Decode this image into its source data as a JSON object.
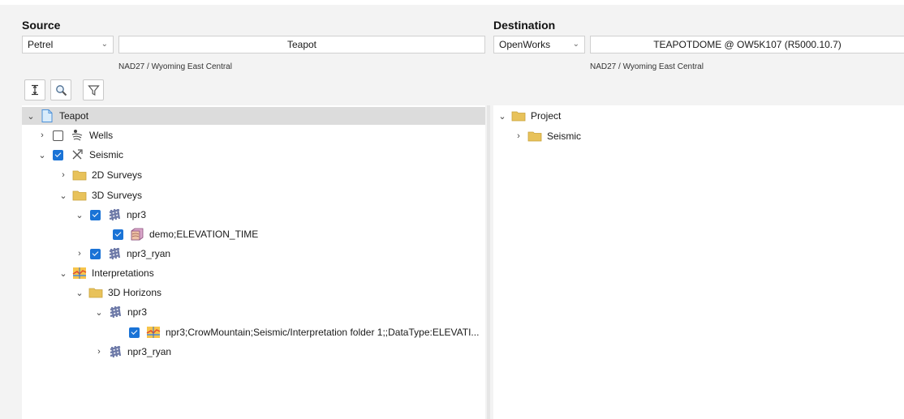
{
  "source": {
    "heading": "Source",
    "app_select": "Petrel",
    "project_name": "Teapot",
    "crs": "NAD27 / Wyoming East Central"
  },
  "destination": {
    "heading": "Destination",
    "app_select": "OpenWorks",
    "project_name": "TEAPOTDOME @ OW5K107 (R5000.10.7)",
    "crs": "NAD27 / Wyoming East Central"
  },
  "toolbar": {
    "buttons": [
      "expand-collapse",
      "search",
      "filter"
    ]
  },
  "source_tree": [
    {
      "label": "Teapot",
      "icon": "file-icon",
      "state": "expanded",
      "selected": true
    },
    {
      "label": "Wells",
      "icon": "wells-icon",
      "state": "collapsed",
      "checked": false
    },
    {
      "label": "Seismic",
      "icon": "seismic-icon",
      "state": "expanded",
      "checked": true
    },
    {
      "label": "2D Surveys",
      "icon": "folder-icon",
      "state": "collapsed"
    },
    {
      "label": "3D Surveys",
      "icon": "folder-icon",
      "state": "expanded"
    },
    {
      "label": "npr3",
      "icon": "survey-icon",
      "state": "expanded",
      "checked": true
    },
    {
      "label": "demo;ELEVATION_TIME",
      "icon": "seismic-cube-icon",
      "checked": true
    },
    {
      "label": "npr3_ryan",
      "icon": "survey-icon",
      "state": "collapsed",
      "checked": true
    },
    {
      "label": "Interpretations",
      "icon": "interpretation-icon",
      "state": "expanded"
    },
    {
      "label": "3D Horizons",
      "icon": "folder-icon",
      "state": "expanded"
    },
    {
      "label": "npr3",
      "icon": "survey-icon",
      "state": "expanded"
    },
    {
      "label": "npr3;CrowMountain;Seismic/Interpretation folder 1;;DataType:ELEVATI...",
      "icon": "interpretation-icon",
      "checked": true
    },
    {
      "label": "npr3_ryan",
      "icon": "survey-icon",
      "state": "collapsed"
    }
  ],
  "dest_tree": [
    {
      "label": "Project",
      "icon": "folder-icon",
      "state": "expanded"
    },
    {
      "label": "Seismic",
      "icon": "folder-icon",
      "state": "collapsed"
    }
  ],
  "colors": {
    "accent": "#1a73d6",
    "folder": "#e8c25a",
    "selection": "#dcdcdc"
  }
}
